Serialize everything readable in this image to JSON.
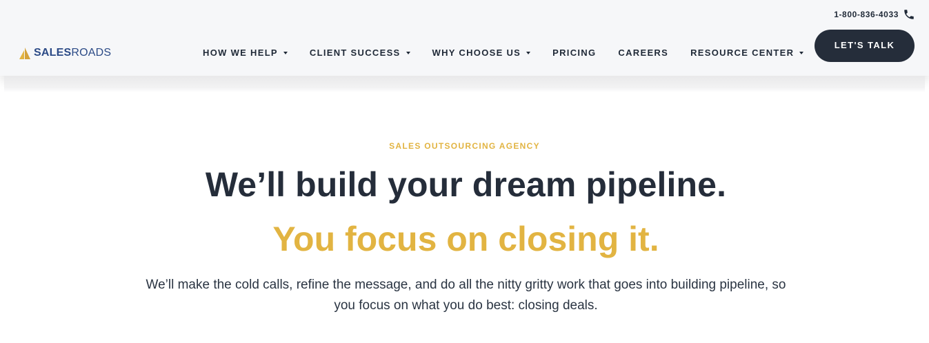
{
  "brand": {
    "logo_bold": "SALES",
    "logo_light": "ROADS",
    "colors": {
      "navy": "#252d3a",
      "gold": "#e2b442",
      "logo_blue": "#2b4a86"
    }
  },
  "header": {
    "phone": "1-800-836-4033",
    "phone_icon": "phone-icon",
    "nav": [
      {
        "label": "HOW WE HELP",
        "has_dropdown": true
      },
      {
        "label": "CLIENT SUCCESS",
        "has_dropdown": true
      },
      {
        "label": "WHY CHOOSE US",
        "has_dropdown": true
      },
      {
        "label": "PRICING",
        "has_dropdown": false
      },
      {
        "label": "CAREERS",
        "has_dropdown": false
      },
      {
        "label": "RESOURCE CENTER",
        "has_dropdown": true
      }
    ],
    "cta_label": "LET'S TALK"
  },
  "hero": {
    "eyebrow": "SALES OUTSOURCING AGENCY",
    "headline": "We’ll build your dream pipeline.",
    "subheadline": "You focus on closing it.",
    "body": "We’ll make the cold calls, refine the message, and do all the nitty gritty work that goes into building pipeline, so you focus on what you do best: closing deals."
  }
}
